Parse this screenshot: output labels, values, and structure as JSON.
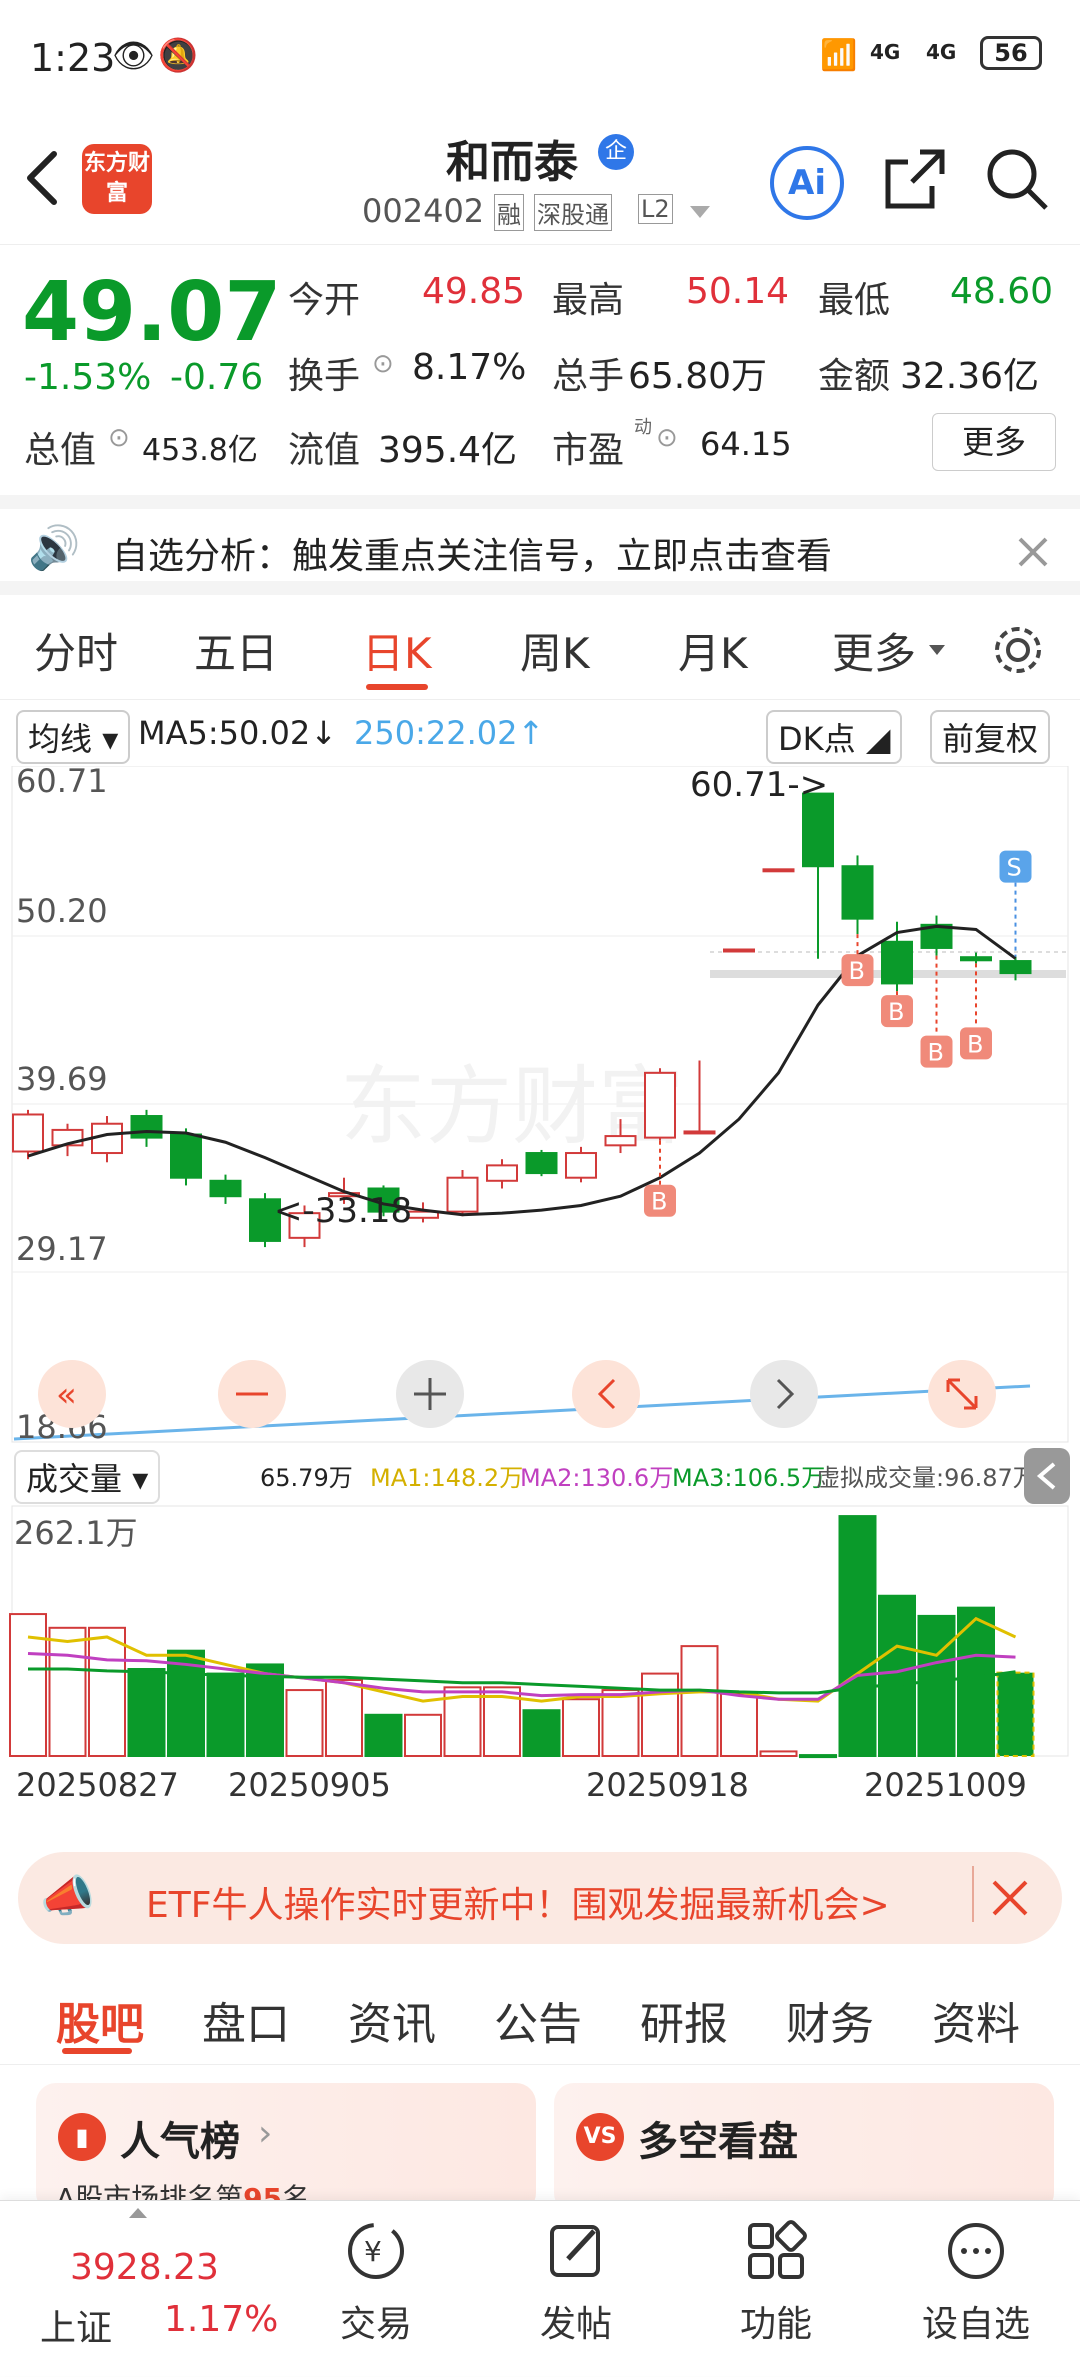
{
  "status_bar": {
    "time": "1:23",
    "net1": "4G",
    "net2": "4G",
    "battery": "56"
  },
  "header": {
    "stock_name": "和而泰",
    "badge": "企",
    "code": "002402",
    "tags": [
      "融",
      "深股通",
      "L2"
    ],
    "logo_text": "东方财富",
    "ai_label": "Ai"
  },
  "quote": {
    "price": "49.07",
    "change_pct": "-1.53%",
    "change": "-0.76",
    "stats": [
      {
        "label": "今开",
        "value": "49.85",
        "color": "red"
      },
      {
        "label": "最高",
        "value": "50.14",
        "color": "red"
      },
      {
        "label": "最低",
        "value": "48.60",
        "color": "green"
      },
      {
        "label": "换手",
        "value": "8.17%",
        "color": "black"
      },
      {
        "label": "总手",
        "value": "65.80万",
        "color": "black"
      },
      {
        "label": "金额",
        "value": "32.36亿",
        "color": "black"
      }
    ],
    "total_value_label": "总值",
    "total_value": "453.8亿",
    "float_value_label": "流值",
    "float_value": "395.4亿",
    "pe_label": "市盈",
    "pe_sup": "动",
    "pe_value": "64.15",
    "more_label": "更多"
  },
  "banner": {
    "text": "自选分析：触发重点关注信号，立即点击查看"
  },
  "tabs": [
    "分时",
    "五日",
    "日K",
    "周K",
    "月K",
    "更多"
  ],
  "active_tab": 2,
  "chart": {
    "ma_btn": "均线",
    "ma5": "MA5:50.02",
    "ma250": "250:22.02",
    "dk_btn": "DK点",
    "fq_btn": "前复权",
    "y_labels": [
      "60.71",
      "50.20",
      "39.69",
      "29.17",
      "18.66"
    ],
    "high_note": "60.71->",
    "low_note": "<-33.18",
    "watermark": "东方财富",
    "vol_btn": "成交量",
    "vol_value": "65.79万",
    "ma1": "MA1:148.2万",
    "ma2": "MA2:130.6万",
    "ma3": "MA3:106.5万",
    "virtual": "虚拟成交量:96.87万",
    "vol_max": "262.1万",
    "dates": [
      "20250827",
      "20250905",
      "20250918",
      "20251009"
    ],
    "buy_mark": "B",
    "sell_mark": "S"
  },
  "chart_data": {
    "type": "candlestick",
    "candles": [
      {
        "o": 37.5,
        "c": 39.9,
        "h": 40.2,
        "l": 37.0
      },
      {
        "o": 37.9,
        "c": 38.9,
        "h": 39.3,
        "l": 37.2
      },
      {
        "o": 37.4,
        "c": 39.3,
        "h": 39.8,
        "l": 36.8
      },
      {
        "o": 39.8,
        "c": 38.4,
        "h": 40.2,
        "l": 37.8
      },
      {
        "o": 38.6,
        "c": 35.8,
        "h": 39.0,
        "l": 35.3
      },
      {
        "o": 35.6,
        "c": 34.6,
        "h": 36.0,
        "l": 34.1
      },
      {
        "o": 34.4,
        "c": 31.7,
        "h": 34.8,
        "l": 31.3
      },
      {
        "o": 31.9,
        "c": 33.5,
        "h": 34.0,
        "l": 31.3
      },
      {
        "o": 34.6,
        "c": 34.8,
        "h": 35.8,
        "l": 34.1
      },
      {
        "o": 35.1,
        "c": 33.6,
        "h": 35.3,
        "l": 33.3
      },
      {
        "o": 33.2,
        "c": 33.6,
        "h": 34.2,
        "l": 32.9
      },
      {
        "o": 33.6,
        "c": 35.8,
        "h": 36.3,
        "l": 33.3
      },
      {
        "o": 35.6,
        "c": 36.6,
        "h": 37.0,
        "l": 35.1
      },
      {
        "o": 37.4,
        "c": 36.1,
        "h": 37.6,
        "l": 35.9
      },
      {
        "o": 35.8,
        "c": 37.4,
        "h": 37.8,
        "l": 35.5
      },
      {
        "o": 37.9,
        "c": 38.5,
        "h": 39.6,
        "l": 37.4
      },
      {
        "o": 38.4,
        "c": 42.6,
        "h": 42.9,
        "l": 38.2
      },
      {
        "o": 38.8,
        "c": 38.8,
        "h": 43.4,
        "l": 38.8
      },
      {
        "o": 50.6,
        "c": 50.6,
        "h": 50.6,
        "l": 50.6
      },
      {
        "o": 55.8,
        "c": 55.8,
        "h": 55.8,
        "l": 55.8
      },
      {
        "o": 60.71,
        "c": 56.0,
        "h": 60.71,
        "l": 50.0
      },
      {
        "o": 56.0,
        "c": 52.6,
        "h": 56.7,
        "l": 51.6
      },
      {
        "o": 51.1,
        "c": 48.4,
        "h": 52.4,
        "l": 47.9
      },
      {
        "o": 52.2,
        "c": 50.7,
        "h": 52.8,
        "l": 50.2
      },
      {
        "o": 50.1,
        "c": 49.9,
        "h": 50.4,
        "l": 49.7
      },
      {
        "o": 49.85,
        "c": 49.07,
        "h": 50.14,
        "l": 48.6
      }
    ],
    "ma5": [
      37.2,
      38.0,
      38.6,
      38.8,
      38.7,
      38.1,
      37.1,
      36.0,
      34.9,
      34.1,
      33.7,
      33.4,
      33.5,
      33.7,
      34.0,
      34.6,
      35.8,
      37.4,
      39.6,
      42.6,
      47.0,
      50.2,
      51.7,
      52.1,
      51.9,
      50.02
    ],
    "volumes": [
      155,
      140,
      140,
      95,
      115,
      90,
      100,
      72,
      83,
      45,
      45,
      75,
      75,
      50,
      62,
      72,
      90,
      120,
      68,
      5,
      1,
      262,
      175,
      153,
      162,
      91
    ],
    "vol_ma1": [
      130,
      125,
      130,
      110,
      110,
      100,
      90,
      85,
      80,
      70,
      60,
      65,
      65,
      60,
      65,
      65,
      68,
      70,
      70,
      62,
      60,
      90,
      120,
      110,
      150,
      130
    ],
    "vol_ma2": [
      112,
      110,
      105,
      104,
      100,
      95,
      90,
      85,
      80,
      74,
      70,
      70,
      70,
      66,
      67,
      67,
      70,
      72,
      66,
      62,
      62,
      88,
      92,
      102,
      110,
      108
    ],
    "vol_ma3": [
      95,
      95,
      93,
      92,
      90,
      88,
      87,
      86,
      86,
      84,
      82,
      80,
      80,
      78,
      76,
      74,
      72,
      72,
      70,
      69,
      69,
      75,
      78,
      82,
      86,
      92
    ]
  },
  "ad": {
    "text": "ETF牛人操作实时更新中！围观发掘最新机会>"
  },
  "subtabs": [
    "股吧",
    "盘口",
    "资讯",
    "公告",
    "研报",
    "财务",
    "资料"
  ],
  "cards": [
    {
      "title": "人气榜",
      "sub": "A股市场排名第",
      "rank": "95",
      "unit": "名"
    },
    {
      "title": "多空看盘"
    }
  ],
  "bottom_nav": {
    "index_value": "3928.23",
    "index_name": "上证",
    "index_change": "1.17%",
    "items": [
      "交易",
      "发帖",
      "功能",
      "设自选"
    ]
  }
}
